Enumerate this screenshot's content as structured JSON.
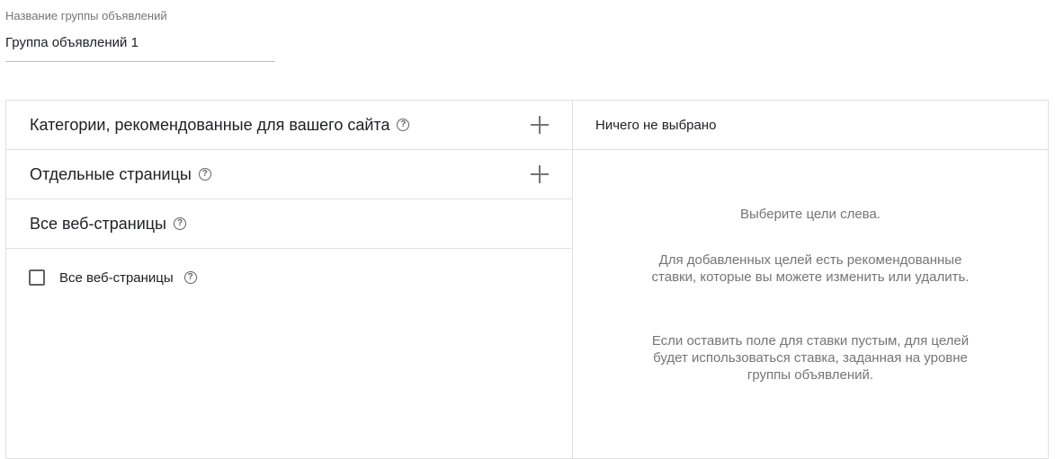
{
  "ad_group": {
    "name_label": "Название группы объявлений",
    "name_value": "Группа объявлений 1"
  },
  "targets": {
    "sections": [
      {
        "label": "Категории, рекомендованные для вашего сайта",
        "help_icon": "?",
        "add_icon": "plus-icon"
      },
      {
        "label": "Отдельные страницы",
        "help_icon": "?",
        "add_icon": "plus-icon"
      },
      {
        "label": "Все веб-страницы",
        "help_icon": "?"
      }
    ],
    "all_pages_checkbox": {
      "label": "Все веб-страницы",
      "checked": false,
      "help_icon": "?"
    }
  },
  "selection": {
    "header": "Ничего не выбрано",
    "messages": [
      "Выберите цели слева.",
      "Для добавленных целей есть рекомендованные ставки, которые вы можете изменить или удалить.",
      "Если оставить поле для ставки пустым, для целей будет использоваться ставка, заданная на уровне группы объявлений."
    ]
  },
  "colors": {
    "border": "#e0e0e0",
    "text_primary": "#202124",
    "text_secondary": "#757575"
  }
}
